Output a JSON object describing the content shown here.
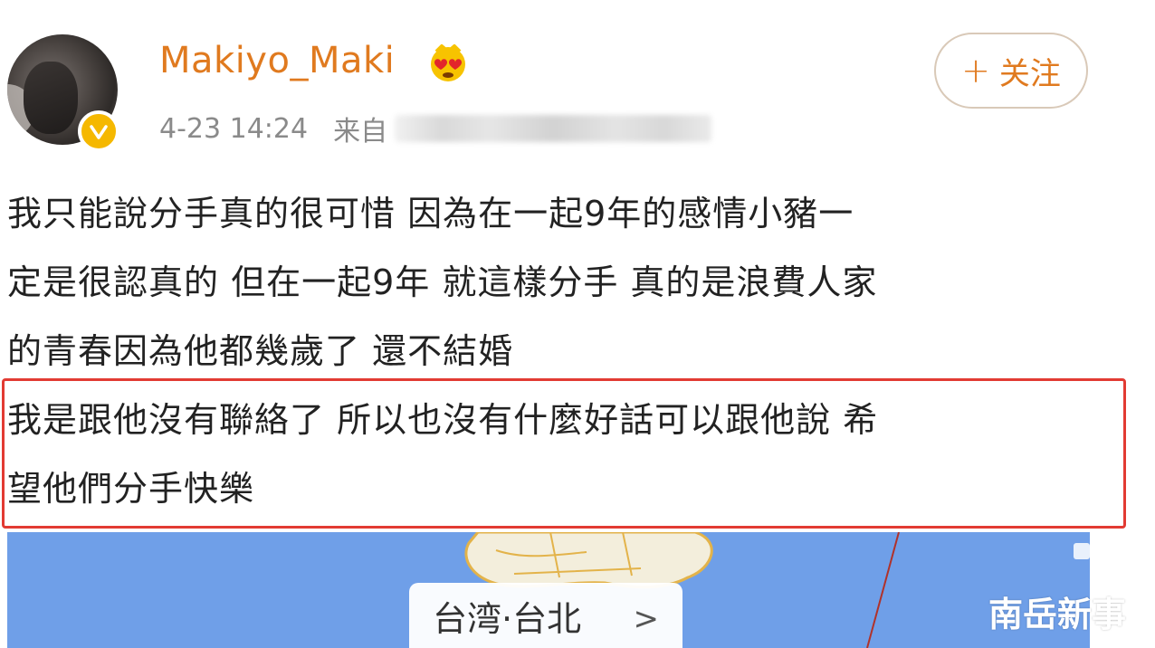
{
  "post": {
    "username": "Makiyo_Maki",
    "time": "4-23 14:24",
    "source_prefix": "来自",
    "follow_label": "关注",
    "follow_plus": "+",
    "lines": [
      "我只能說分手真的很可惜 因為在一起9年的感情小豬一",
      "定是很認真的 但在一起9年 就這樣分手 真的是浪費人家",
      "的青春因為他都幾歲了 還不結婚",
      "我是跟他沒有聯絡了 所以也沒有什麼好話可以跟他說 希",
      "望他們分手快樂"
    ],
    "location": "台湾·台北",
    "location_chevron": ">"
  },
  "watermark": "南岳新事",
  "colors": {
    "username": "#e07a1f",
    "highlight_border": "#e23b33",
    "map_water": "#6f9fe8",
    "verified_badge": "#f5b800"
  },
  "icons": {
    "verified": "verified-badge-icon",
    "vip": "vip-heart-eyes-icon",
    "chevron": "chevron-right-icon"
  }
}
